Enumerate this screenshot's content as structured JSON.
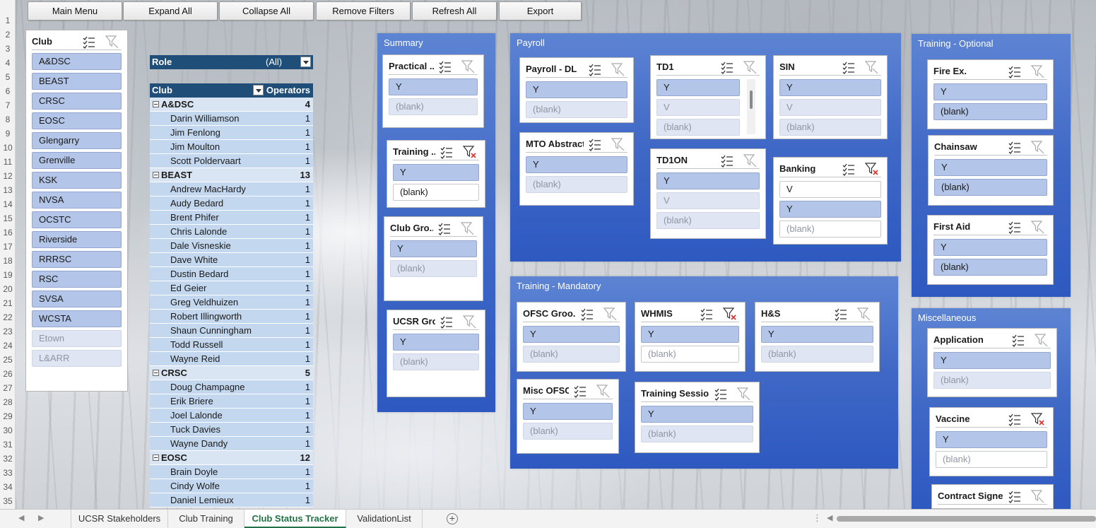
{
  "toolbar": {
    "main_menu": "Main Menu",
    "expand_all": "Expand All",
    "collapse_all": "Collapse All",
    "remove_filters": "Remove Filters",
    "refresh_all": "Refresh All",
    "export": "Export"
  },
  "rows": [
    "1",
    "2",
    "3",
    "4",
    "5",
    "6",
    "7",
    "8",
    "9",
    "10",
    "11",
    "12",
    "13",
    "14",
    "15",
    "16",
    "17",
    "18",
    "19",
    "20",
    "21",
    "22",
    "23",
    "24",
    "25",
    "26",
    "27",
    "28",
    "29",
    "30",
    "31",
    "32",
    "33",
    "34",
    "35"
  ],
  "club_slicer": {
    "title": "Club",
    "items": [
      {
        "label": "A&DSC",
        "state": "sel"
      },
      {
        "label": "BEAST",
        "state": "sel"
      },
      {
        "label": "CRSC",
        "state": "sel"
      },
      {
        "label": "EOSC",
        "state": "sel"
      },
      {
        "label": "Glengarry",
        "state": "sel"
      },
      {
        "label": "Grenville",
        "state": "sel"
      },
      {
        "label": "KSK",
        "state": "sel"
      },
      {
        "label": "NVSA",
        "state": "sel"
      },
      {
        "label": "OCSTC",
        "state": "sel"
      },
      {
        "label": "Riverside",
        "state": "sel"
      },
      {
        "label": "RRRSC",
        "state": "sel"
      },
      {
        "label": "RSC",
        "state": "sel"
      },
      {
        "label": "SVSA",
        "state": "sel"
      },
      {
        "label": "WCSTA",
        "state": "sel"
      },
      {
        "label": "Etown",
        "state": "nodata"
      },
      {
        "label": "L&ARR",
        "state": "nodata"
      }
    ]
  },
  "pivot": {
    "filter_label": "Role",
    "filter_value": "(All)",
    "col_club": "Club",
    "col_operators": "Operators",
    "rows": [
      {
        "type": "grp",
        "name": "A&DSC",
        "value": "4"
      },
      {
        "type": "item",
        "name": "Darin Williamson",
        "value": "1"
      },
      {
        "type": "item",
        "name": "Jim Fenlong",
        "value": "1"
      },
      {
        "type": "item",
        "name": "Jim Moulton",
        "value": "1"
      },
      {
        "type": "item",
        "name": "Scott Poldervaart",
        "value": "1"
      },
      {
        "type": "grp",
        "name": "BEAST",
        "value": "13"
      },
      {
        "type": "item",
        "name": "Andrew MacHardy",
        "value": "1"
      },
      {
        "type": "item",
        "name": "Audy Bedard",
        "value": "1"
      },
      {
        "type": "item",
        "name": "Brent Phifer",
        "value": "1"
      },
      {
        "type": "item",
        "name": "Chris Lalonde",
        "value": "1"
      },
      {
        "type": "item",
        "name": "Dale Visneskie",
        "value": "1"
      },
      {
        "type": "item",
        "name": "Dave White",
        "value": "1"
      },
      {
        "type": "item",
        "name": "Dustin Bedard",
        "value": "1"
      },
      {
        "type": "item",
        "name": "Ed Geier",
        "value": "1"
      },
      {
        "type": "item",
        "name": "Greg Veldhuizen",
        "value": "1"
      },
      {
        "type": "item",
        "name": "Robert Illingworth",
        "value": "1"
      },
      {
        "type": "item",
        "name": "Shaun Cunningham",
        "value": "1"
      },
      {
        "type": "item",
        "name": "Todd Russell",
        "value": "1"
      },
      {
        "type": "item",
        "name": "Wayne Reid",
        "value": "1"
      },
      {
        "type": "grp",
        "name": "CRSC",
        "value": "5"
      },
      {
        "type": "item",
        "name": "Doug Champagne",
        "value": "1"
      },
      {
        "type": "item",
        "name": "Erik Briere",
        "value": "1"
      },
      {
        "type": "item",
        "name": "Joel Lalonde",
        "value": "1"
      },
      {
        "type": "item",
        "name": "Tuck Davies",
        "value": "1"
      },
      {
        "type": "item",
        "name": "Wayne Dandy",
        "value": "1"
      },
      {
        "type": "grp",
        "name": "EOSC",
        "value": "12"
      },
      {
        "type": "item",
        "name": "Brain Doyle",
        "value": "1"
      },
      {
        "type": "item",
        "name": "Cindy Wolfe",
        "value": "1"
      },
      {
        "type": "item",
        "name": "Daniel Lemieux",
        "value": "1"
      }
    ]
  },
  "panels": {
    "summary": "Summary",
    "payroll": "Payroll",
    "training_optional": "Training - Optional",
    "training_mandatory": "Training - Mandatory",
    "miscellaneous": "Miscellaneous"
  },
  "slicers": {
    "practical": {
      "title": "Practical ...",
      "items": [
        "Y",
        "(blank)"
      ]
    },
    "training": {
      "title": "Training ...",
      "items": [
        "Y",
        "(blank)"
      ]
    },
    "club_group": {
      "title": "Club Gro...",
      "items": [
        "Y",
        "(blank)"
      ]
    },
    "ucsr_group": {
      "title": "UCSR Gro...",
      "items": [
        "Y",
        "(blank)"
      ]
    },
    "payroll_dl": {
      "title": "Payroll - DL",
      "items": [
        "Y",
        "(blank)"
      ]
    },
    "mto_abstract": {
      "title": "MTO Abstract",
      "items": [
        "Y",
        "(blank)"
      ]
    },
    "td1": {
      "title": "TD1",
      "items": [
        "Y",
        "V",
        "(blank)"
      ]
    },
    "sin": {
      "title": "SIN",
      "items": [
        "Y",
        "V",
        "(blank)"
      ]
    },
    "td1on": {
      "title": "TD1ON",
      "items": [
        "Y",
        "V",
        "(blank)"
      ]
    },
    "banking": {
      "title": "Banking",
      "items": [
        "V",
        "Y",
        "(blank)"
      ]
    },
    "fire_ex": {
      "title": "Fire Ex.",
      "items": [
        "Y",
        "(blank)"
      ]
    },
    "chainsaw": {
      "title": "Chainsaw",
      "items": [
        "Y",
        "(blank)"
      ]
    },
    "first_aid": {
      "title": "First Aid",
      "items": [
        "Y",
        "(blank)"
      ]
    },
    "ofsc_groom": {
      "title": "OFSC Groo...",
      "items": [
        "Y",
        "(blank)"
      ]
    },
    "whmis": {
      "title": "WHMIS",
      "items": [
        "Y",
        "(blank)"
      ]
    },
    "hs": {
      "title": "H&S",
      "items": [
        "Y",
        "(blank)"
      ]
    },
    "misc_ofsc": {
      "title": "Misc OFSC",
      "items": [
        "Y",
        "(blank)"
      ]
    },
    "training_session": {
      "title": "Training Session",
      "items": [
        "Y",
        "(blank)"
      ]
    },
    "application": {
      "title": "Application",
      "items": [
        "Y",
        "(blank)"
      ]
    },
    "vaccine": {
      "title": "Vaccine",
      "items": [
        "Y",
        "(blank)"
      ]
    },
    "contract_signed": {
      "title": "Contract Signed",
      "items": []
    }
  },
  "tabs": [
    "UCSR Stakeholders",
    "Club Training",
    "Club Status Tracker",
    "ValidationList"
  ],
  "active_tab": "Club Status Tracker"
}
